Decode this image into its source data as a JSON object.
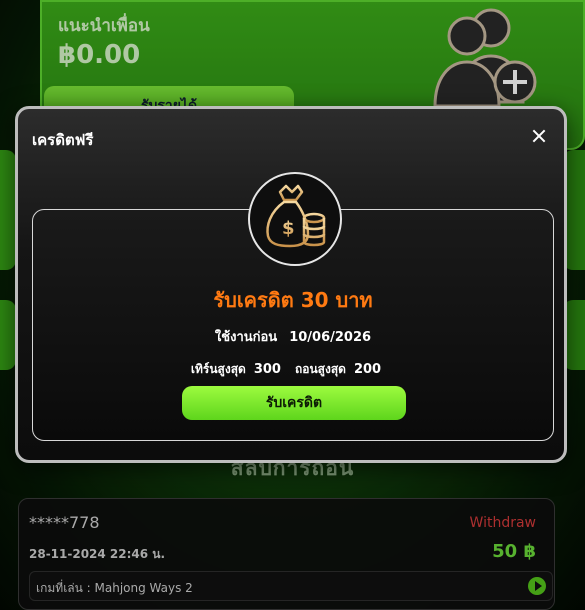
{
  "background": {
    "referral_card": {
      "label": "แนะนำเพื่อน",
      "amount": "฿0.00",
      "button_label": "รับรายได้",
      "icon": "add-user-icon"
    },
    "section_heading": "สลิปการถอน",
    "history_item": {
      "masked_account": "*****778",
      "status": "Withdraw",
      "datetime": "28-11-2024 22:46 น.",
      "amount": "50 ฿",
      "game_label": "เกมที่เล่น : Mahjong Ways 2",
      "play_icon": "play-icon"
    }
  },
  "modal": {
    "title": "เครดิตฟรี",
    "close_icon": "close-icon",
    "hero_icon": "money-bag-icon",
    "offer_title": "รับเครดิต 30 บาท",
    "use_before_label": "ใช้งานก่อน",
    "use_before_date": "10/06/2026",
    "max_turn_label": "เทิร์นสูงสุด",
    "max_turn_value": "300",
    "max_withdraw_label": "ถอนสูงสุด",
    "max_withdraw_value": "200",
    "claim_button": "รับเครดิต"
  },
  "colors": {
    "accent_orange": "#ff7a12",
    "accent_green": "#5ed51c",
    "withdraw_red": "#d23a3a"
  }
}
